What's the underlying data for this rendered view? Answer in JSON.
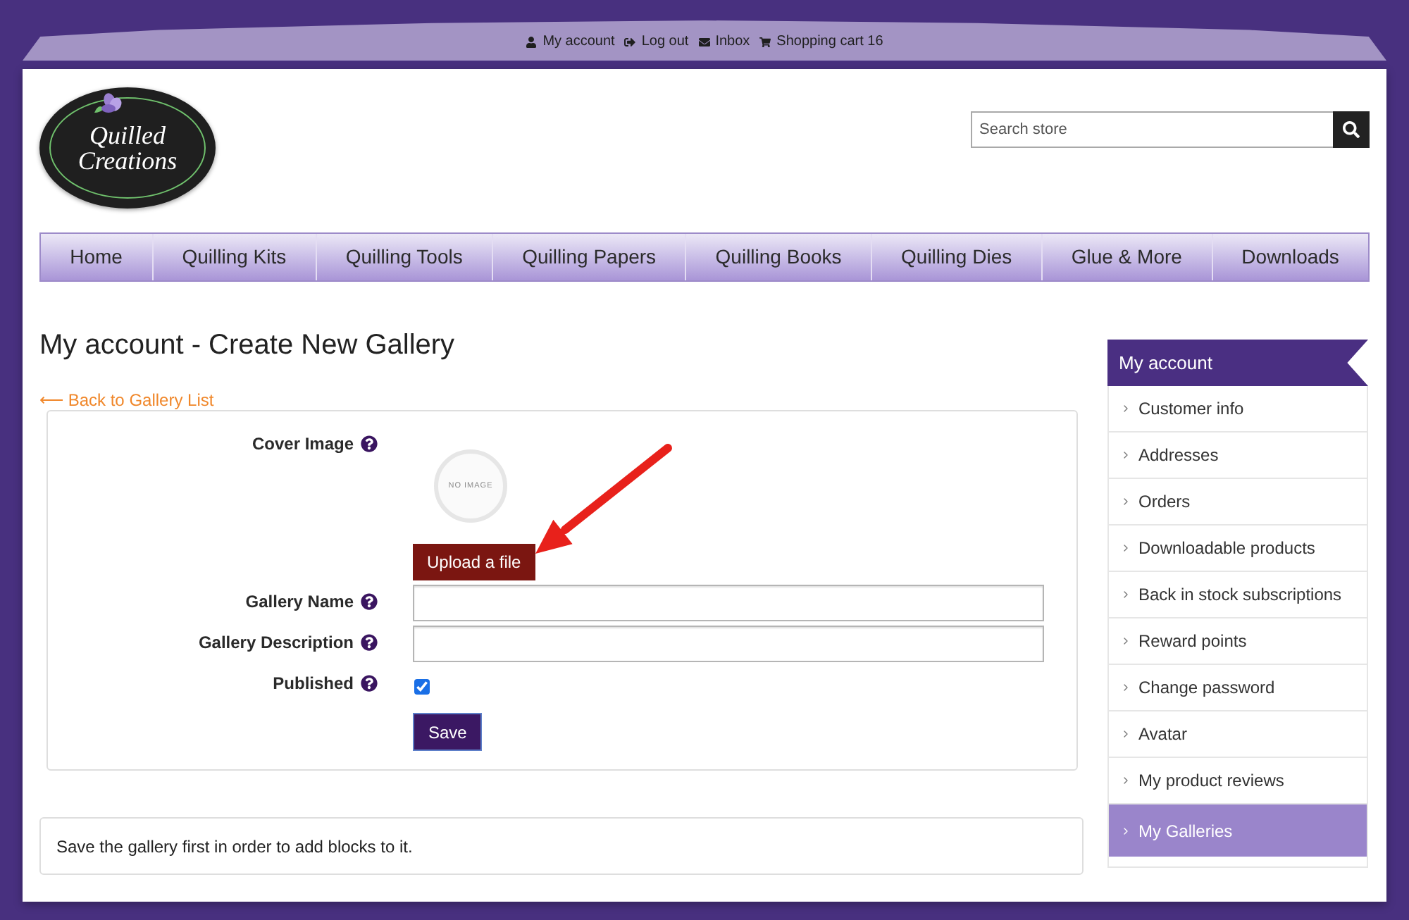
{
  "top_links": [
    "My account",
    "Log out",
    "Inbox",
    "Shopping cart 16"
  ],
  "logo": {
    "lines": [
      "Quilled",
      "Creations"
    ]
  },
  "search": {
    "placeholder": "Search store"
  },
  "nav": [
    "Home",
    "Quilling Kits",
    "Quilling Tools",
    "Quilling Papers",
    "Quilling Books",
    "Quilling Dies",
    "Glue & More",
    "Downloads"
  ],
  "page_title": "My account - Create New Gallery",
  "back_link": "⟵ Back to Gallery List",
  "form": {
    "fields": [
      {
        "kind": "image",
        "label": "Cover Image",
        "image_text": "NO IMAGE",
        "button": "Upload a file"
      },
      {
        "kind": "text",
        "label": "Gallery Name"
      },
      {
        "kind": "text",
        "label": "Gallery Description"
      },
      {
        "kind": "checkbox",
        "label": "Published",
        "checked": true
      }
    ],
    "submit": "Save"
  },
  "notice": "Save the gallery first in order to add blocks to it.",
  "sidebar": {
    "title": "My account",
    "items": [
      {
        "label": "Customer info",
        "selected": false
      },
      {
        "label": "Addresses",
        "selected": false
      },
      {
        "label": "Orders",
        "selected": false
      },
      {
        "label": "Downloadable products",
        "selected": false
      },
      {
        "label": "Back in stock subscriptions",
        "selected": false
      },
      {
        "label": "Reward points",
        "selected": false
      },
      {
        "label": "Change password",
        "selected": false
      },
      {
        "label": "Avatar",
        "selected": false
      },
      {
        "label": "My product reviews",
        "selected": false
      },
      {
        "label": "My Galleries",
        "selected": true
      }
    ]
  }
}
